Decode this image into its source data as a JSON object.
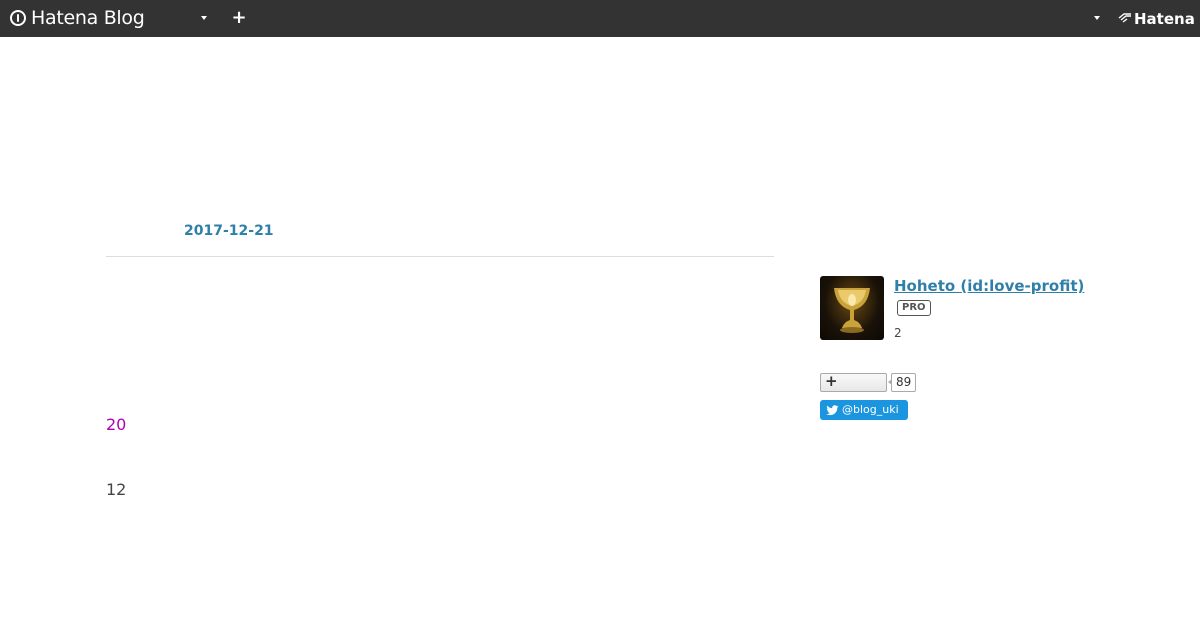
{
  "topbar": {
    "brand": "Hatena Blog",
    "hatena": "Hatena",
    "plus_symbol": "+"
  },
  "entry": {
    "date": "2017-12-21",
    "values": [
      "20",
      "12"
    ]
  },
  "profile": {
    "name": "Hoheto (id:love-profit)",
    "badge": "PRO",
    "count": "2"
  },
  "follow": {
    "plus_symbol": "+",
    "count": "89"
  },
  "twitter": {
    "handle": "@blog_uki"
  },
  "colors": {
    "topbar": "#333333",
    "link": "#2f7fa8",
    "magenta": "#b000b5",
    "twitter": "#1b95e0"
  }
}
